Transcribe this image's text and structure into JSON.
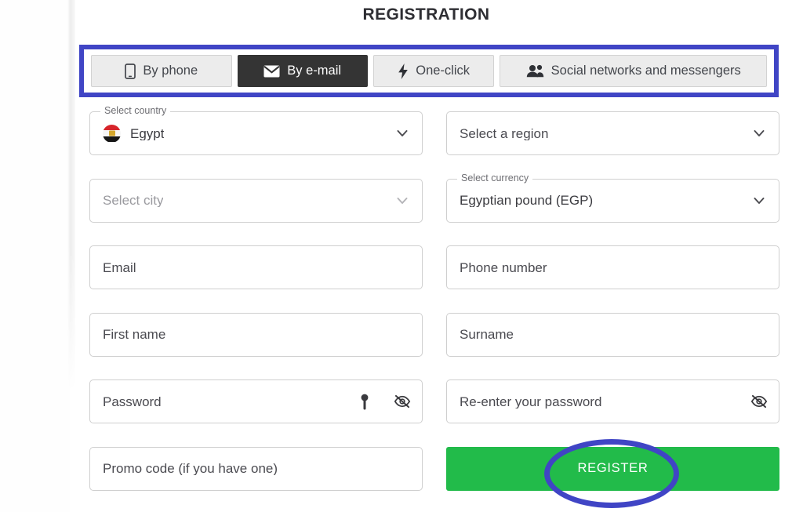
{
  "page": {
    "title": "REGISTRATION"
  },
  "tabs": [
    {
      "label": "By phone",
      "icon": "phone-icon",
      "active": false
    },
    {
      "label": "By e-mail",
      "icon": "envelope-icon",
      "active": true
    },
    {
      "label": "One-click",
      "icon": "lightning-bolt-icon",
      "active": false
    },
    {
      "label": "Social networks and messengers",
      "icon": "people-group-icon",
      "active": false
    }
  ],
  "form": {
    "country": {
      "legend": "Select country",
      "value": "Egypt",
      "flag": "egypt-flag-icon",
      "chevron": "chevron-down-icon",
      "disabled": false
    },
    "region": {
      "legend": "",
      "value": "Select a region",
      "chevron": "chevron-down-icon",
      "disabled": false
    },
    "city": {
      "legend": "",
      "value": "Select city",
      "chevron": "chevron-down-icon",
      "disabled": true
    },
    "currency": {
      "legend": "Select currency",
      "value": "Egyptian pound (EGP)",
      "chevron": "chevron-down-icon",
      "disabled": false
    },
    "email": {
      "placeholder": "Email",
      "value": ""
    },
    "phone": {
      "placeholder": "Phone number",
      "value": ""
    },
    "first_name": {
      "placeholder": "First name",
      "value": ""
    },
    "surname": {
      "placeholder": "Surname",
      "value": ""
    },
    "password": {
      "placeholder": "Password",
      "value": "",
      "icons": [
        "key-icon",
        "eye-slash-icon"
      ]
    },
    "password_repeat": {
      "placeholder": "Re-enter your password",
      "value": "",
      "icons": [
        "eye-slash-icon"
      ]
    },
    "promo_code": {
      "placeholder": "Promo code (if you have one)",
      "value": ""
    },
    "submit": {
      "label": "REGISTER"
    }
  },
  "colors": {
    "accent_green": "#22bb4a",
    "annotation_blue": "#4045c5",
    "active_tab_bg": "#343434",
    "tab_bg": "#ececec",
    "field_border": "#cfcfcf",
    "text_primary": "#3b3b40",
    "text_muted": "#9a9a9f"
  }
}
